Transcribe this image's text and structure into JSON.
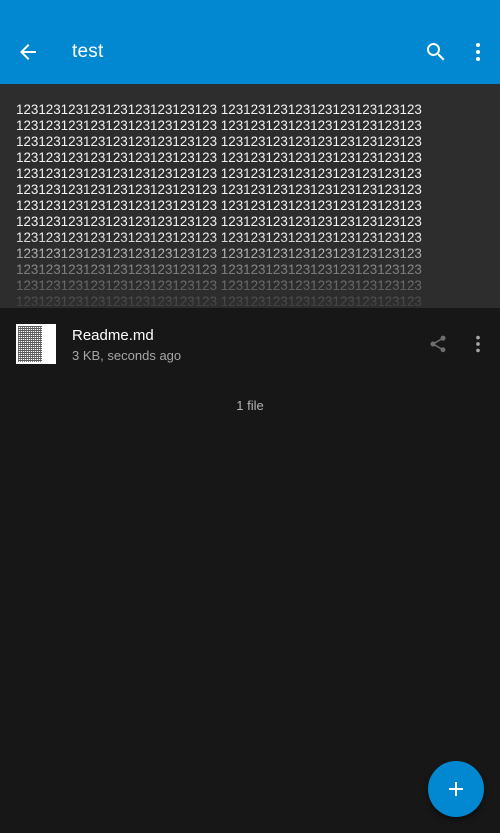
{
  "colors": {
    "toolbar": "#0288d1",
    "background": "#171717",
    "preview_background": "#2d2d2d",
    "fab": "#0288d1",
    "text_primary": "#ffffff",
    "text_secondary": "#a6a6a6"
  },
  "toolbar": {
    "title": "test",
    "back_icon": "arrow-back-icon",
    "search_icon": "search-icon",
    "overflow_icon": "more-vert-icon"
  },
  "readme_preview": {
    "text": "123123123123123123123123123 123123123123123123123123123\n123123123123123123123123123 123123123123123123123123123\n123123123123123123123123123 123123123123123123123123123\n123123123123123123123123123 123123123123123123123123123\n123123123123123123123123123 123123123123123123123123123\n123123123123123123123123123 123123123123123123123123123\n123123123123123123123123123 123123123123123123123123123\n123123123123123123123123123 123123123123123123123123123\n123123123123123123123123123 123123123123123123123123123\n123123123123123123123123123 123123123123123123123123123\n123123123123123123123123123 123123123123123123123123123\n123123123123123123123123123 123123123123123123123123123\n123123123123123123123123123 123123123123123123123123123"
  },
  "files": [
    {
      "name": "Readme.md",
      "meta": "3 KB, seconds ago",
      "share_icon": "share-icon",
      "more_icon": "more-vert-icon"
    }
  ],
  "file_count": "1 file",
  "fab": {
    "icon": "add-icon"
  }
}
